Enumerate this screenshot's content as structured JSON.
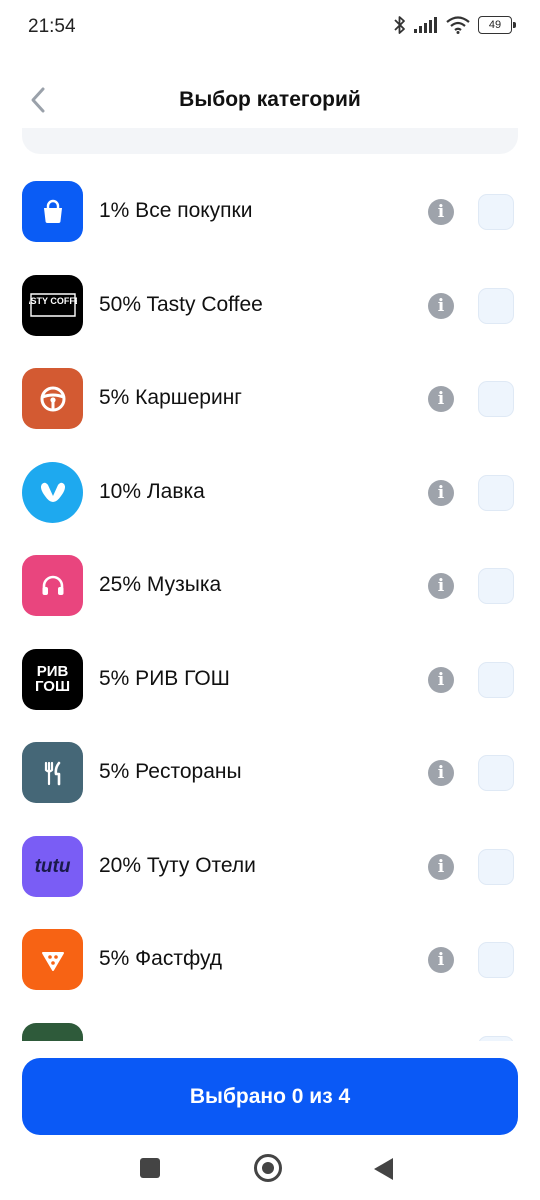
{
  "status_bar": {
    "time": "21:54",
    "battery": "49",
    "icons": [
      "bluetooth-icon",
      "signal-icon",
      "wifi-icon",
      "battery-icon"
    ]
  },
  "header": {
    "title": "Выбор категорий",
    "back_icon": "chevron-left-icon"
  },
  "categories": [
    {
      "label": "1% Все покупки",
      "logo": "shopping-bag-icon",
      "color": "#0a5cf5"
    },
    {
      "label": "50% Tasty Coffee",
      "logo": "tasty-coffee-logo",
      "logo_text": "TASTY COFFEE",
      "color": "#000000"
    },
    {
      "label": "5% Каршеринг",
      "logo": "steering-wheel-icon",
      "color": "#d35a32"
    },
    {
      "label": "10% Лавка",
      "logo": "lavka-logo",
      "color": "#1ea9ef"
    },
    {
      "label": "25% Музыка",
      "logo": "headphones-icon",
      "color": "#e9457e"
    },
    {
      "label": "5% РИВ ГОШ",
      "logo": "riv-gosh-logo",
      "logo_text": "РИВ ГОШ",
      "color": "#000000"
    },
    {
      "label": "5% Рестораны",
      "logo": "fork-knife-icon",
      "color": "#456777"
    },
    {
      "label": "20% Туту Отели",
      "logo": "tutu-logo",
      "logo_text": "tutu",
      "color": "#7a5df5"
    },
    {
      "label": "5% Фастфуд",
      "logo": "pizza-icon",
      "color": "#f76314"
    },
    {
      "label": "",
      "logo": "partial-logo",
      "color": "#2e5a3a"
    }
  ],
  "info_icon": "info-icon",
  "select_button": {
    "label": "Выбрано 0 из 4"
  },
  "nav_bar": {
    "icons": [
      "recents-icon",
      "home-icon",
      "back-icon"
    ]
  },
  "colors": {
    "accent": "#0a59f6",
    "checkbox_bg": "#eef5fd",
    "info": "#9ea3ab"
  }
}
